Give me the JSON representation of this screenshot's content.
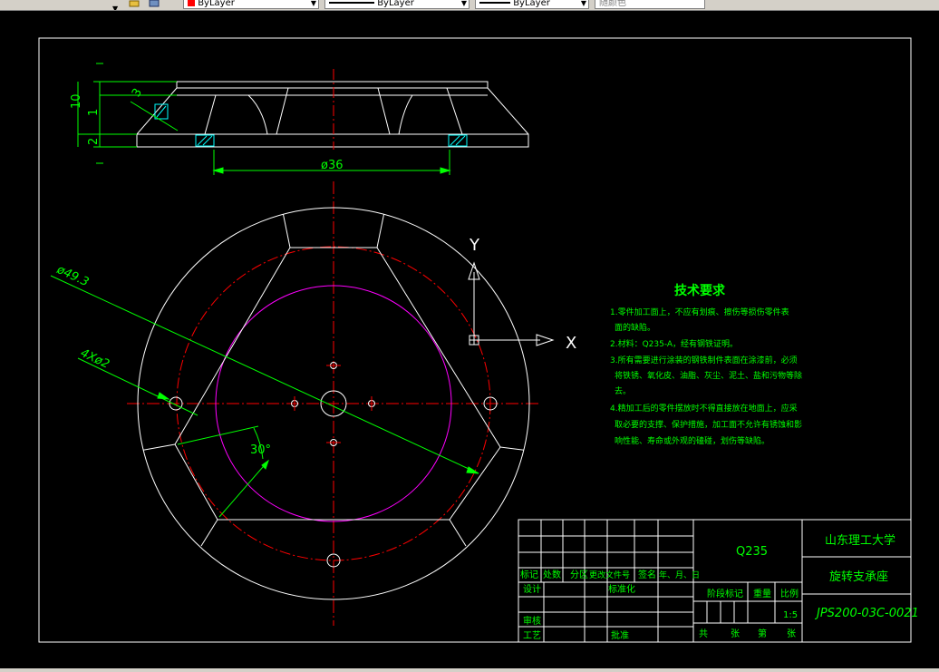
{
  "toolbar": {
    "layer_color_label": "ByLayer",
    "linetype_label": "ByLayer",
    "lineweight_label": "ByLayer",
    "plotstyle_label": "随颜色"
  },
  "drawing": {
    "dims": {
      "height_total": "10",
      "height_mid": "1",
      "height_base": "2",
      "slot": "3",
      "bore": "ø36",
      "outer_dia": "ø49.3",
      "holes": "4Xø2",
      "angle": "30°"
    },
    "ucs": {
      "x": "X",
      "y": "Y"
    }
  },
  "tech_req": {
    "title": "技术要求",
    "items": [
      "1.零件加工面上，不应有划痕、擦伤等损伤零件表",
      "面的缺陷。",
      "2.材料：Q235-A，经有钢铁证明。",
      "3.所有需要进行涂装的钢铁制件表面在涂漆前，必须",
      "将铁锈、氧化皮、油脂、灰尘、泥土、盐和污物等除",
      "去。",
      "4.精加工后的零件摆放时不得直接放在地面上，应采",
      "取必要的支撑、保护措施，加工面不允许有锈蚀和影",
      "响性能、寿命或外观的磕碰，划伤等缺陷。"
    ]
  },
  "title_block": {
    "material": "Q235",
    "school": "山东理工大学",
    "part_name": "旋转支承座",
    "drawing_no": "JPS200-03C-0021",
    "scale": "1:5",
    "headers": {
      "mark": "标记",
      "count": "处数",
      "zone": "分区",
      "change_doc": "更改文件号",
      "sign": "签名",
      "date": "年、月、日",
      "design": "设计",
      "standard": "标准化",
      "stage": "阶段标记",
      "weight": "重量",
      "ratio": "比例",
      "check": "审核",
      "process": "工艺",
      "approve": "批准",
      "total": "共",
      "sheets1": "张",
      "page": "第",
      "sheets2": "张"
    }
  },
  "colors": {
    "white": "#ffffff",
    "green": "#00ff00",
    "red": "#ff0000",
    "magenta": "#ff00ff",
    "cyan": "#00ffff"
  }
}
